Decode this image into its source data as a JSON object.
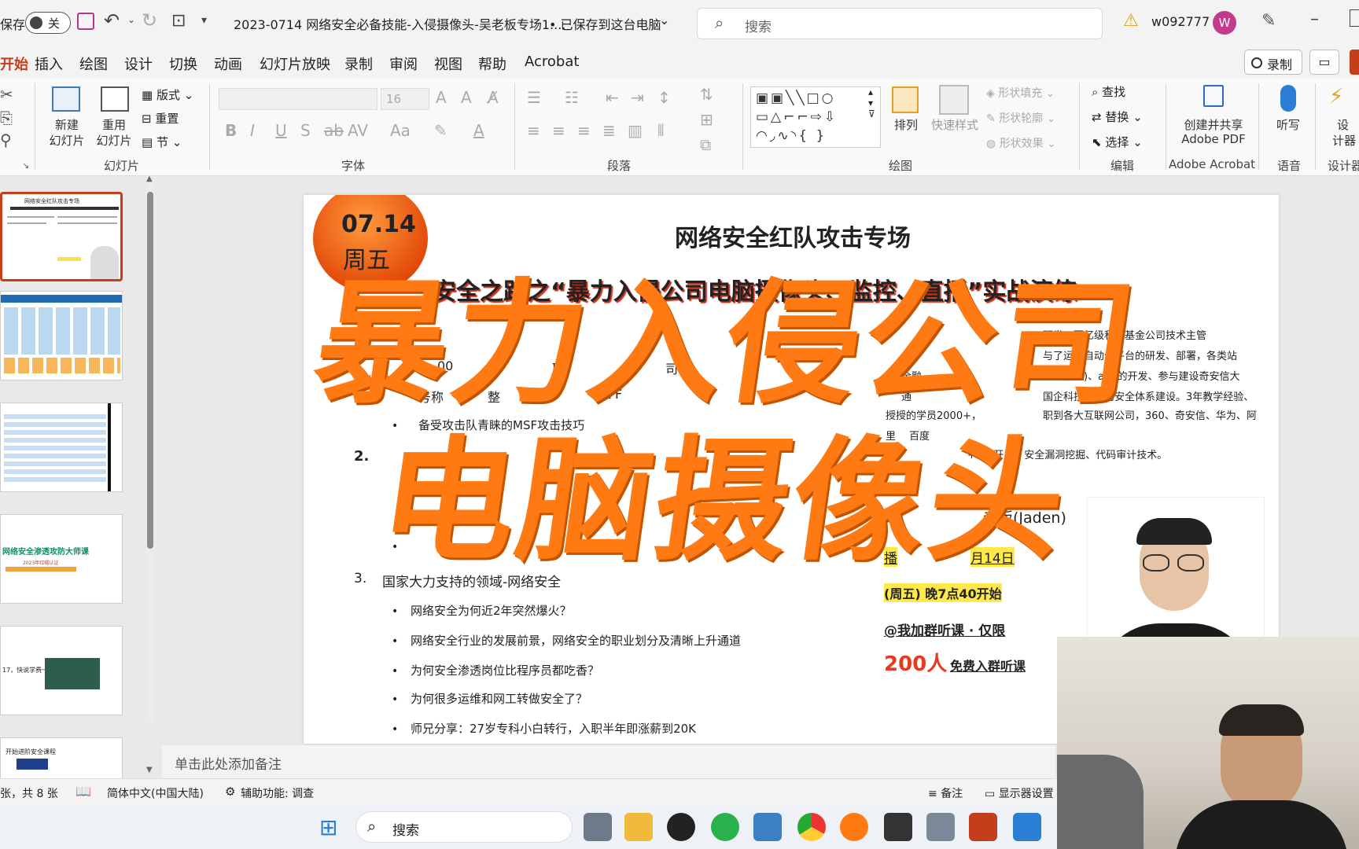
{
  "titlebar": {
    "autosave": "保存",
    "toggle": "关",
    "doc_title": "2023-0714 网络安全必备技能-入侵摄像头-吴老板专场1....",
    "saved": "• 已保存到这台电脑",
    "search_placeholder": "搜索",
    "user": "w092777",
    "avatar_letter": "W"
  },
  "menu": {
    "items": [
      "开始",
      "插入",
      "绘图",
      "设计",
      "切换",
      "动画",
      "幻灯片放映",
      "录制",
      "审阅",
      "视图",
      "帮助",
      "Acrobat"
    ],
    "record": "录制"
  },
  "ribbon": {
    "new_slide": "新建",
    "new_slide2": "幻灯片",
    "reuse": "重用",
    "reuse2": "幻灯片",
    "layout": "版式",
    "reset": "重置",
    "section": "节",
    "group_slides": "幻灯片",
    "group_font": "字体",
    "group_para": "段落",
    "group_draw": "绘图",
    "group_edit": "编辑",
    "group_acrobat": "Adobe Acrobat",
    "group_voice": "语音",
    "group_designer": "设计器",
    "font_size": "16",
    "arrange": "排列",
    "quick_styles": "快速样式",
    "shape_fill": "形状填充",
    "shape_outline": "形状轮廓",
    "shape_effects": "形状效果",
    "find": "查找",
    "replace": "替换",
    "select": "选择",
    "create_pdf": "创建并共享",
    "create_pdf2": "Adobe PDF",
    "dictate": "听写",
    "designer": "设",
    "designer2": "计器"
  },
  "slide": {
    "date": "07.14",
    "weekday": "周五",
    "title": "网络安全红队攻击专场",
    "subtitle": "安全之路之“暴力入侵公司电脑摄像头、监控、直播”实战演练",
    "overlay_line1": "暴力入侵公司",
    "overlay_line2": "电脑摄像头",
    "left_items": [
      "00",
      "取",
      "司",
      "号称",
      "整",
      "loit F",
      "备受攻击队青睐的MSF攻击技巧"
    ],
    "num2": "2.",
    "num3": "3.",
    "section3": "国家大力支持的领域-网络安全",
    "bullets3": [
      "网络安全为何近2年突然爆火？",
      "网络安全行业的发展前景，网络安全的职业划分及清晰上升通道",
      "为何安全渗透岗位比程序员都吃香？",
      "为何很多运维和网工转做安全了？",
      "师兄分享：27岁专科小白转行，入职半年即涨薪到20K"
    ],
    "bio": [
      "研发、百亿级私募基金公司技术主管",
      "与了运维自动化平台的研发、部署，各类站",
      "全融",
      "、直播等)、app的开发、参与建设奇安信大",
      "通",
      "国企科技公司的安全体系建设。3年教学经验、",
      "授授的学员2000+，",
      "职到各大互联网公司，360、奇安信、华为、阿",
      "里",
      "百度",
      "+\\Go开发、安全漏洞挖掘、代码审计技术。"
    ],
    "teacher": "老板(Jaden)",
    "date_line": "月14日",
    "date_prefix": "播",
    "time_line": "(周五) 晚7点40开始",
    "join_line": "@我加群听课 · 仅限",
    "seats_num": "200人",
    "seats_text": "免费入群听课"
  },
  "thumbs": {
    "t1_title": "网络安全红队攻击专场",
    "t4_title": "网络安全渗透攻防大师课",
    "t4_sub": "2023年红帽认证",
    "t5_text": "17，快说学费一",
    "t6_text": "开始进阶安全课程"
  },
  "notes": {
    "placeholder": "单击此处添加备注"
  },
  "status": {
    "slides": "张，共 8 张",
    "language": "简体中文(中国大陆)",
    "accessibility": "辅助功能: 调查",
    "notes_btn": "备注",
    "display": "显示器设置"
  },
  "taskbar": {
    "search": "搜索"
  },
  "colors": {
    "accent": "#c43e1c",
    "overlay": "#ff7a12",
    "highlight": "#ffe94a",
    "red_text": "#e53a1e"
  }
}
